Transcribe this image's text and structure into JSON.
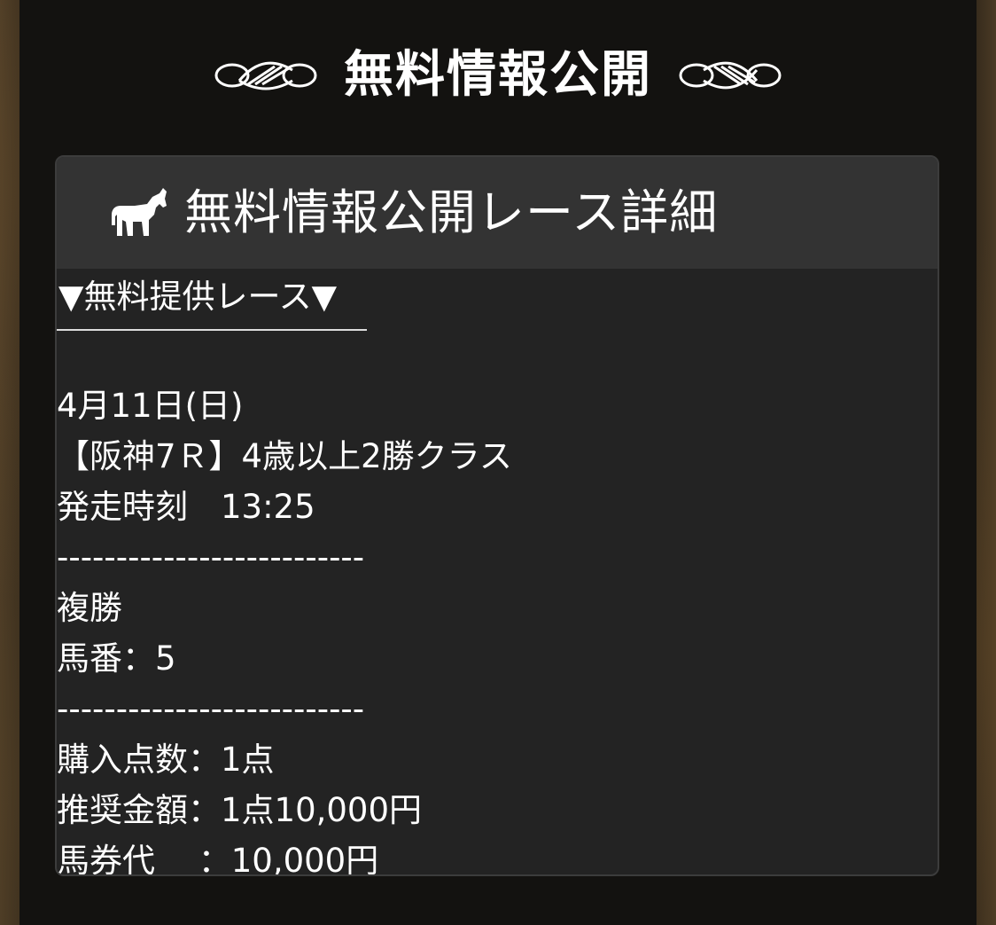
{
  "page": {
    "title": "無料情報公開"
  },
  "card": {
    "title": "無料情報公開レース詳細",
    "icon": "horse-icon",
    "section_heading": "▼無料提供レース▼",
    "lines": {
      "date": "4月11日(日)",
      "race": "【阪神7Ｒ】4歳以上2勝クラス",
      "start_time": "発走時刻　13:25",
      "separator_1": "--------------------------",
      "bet_type": "複勝",
      "horse_number": "馬番：5",
      "separator_2": "--------------------------",
      "purchase_count": "購入点数：1点",
      "recommended_amount": "推奨金額：1点10,000円",
      "ticket_cost": "馬券代　 ：10,000円"
    }
  },
  "colors": {
    "header_bg": "#333333",
    "card_bg": "#232323",
    "text": "#ffffff"
  }
}
